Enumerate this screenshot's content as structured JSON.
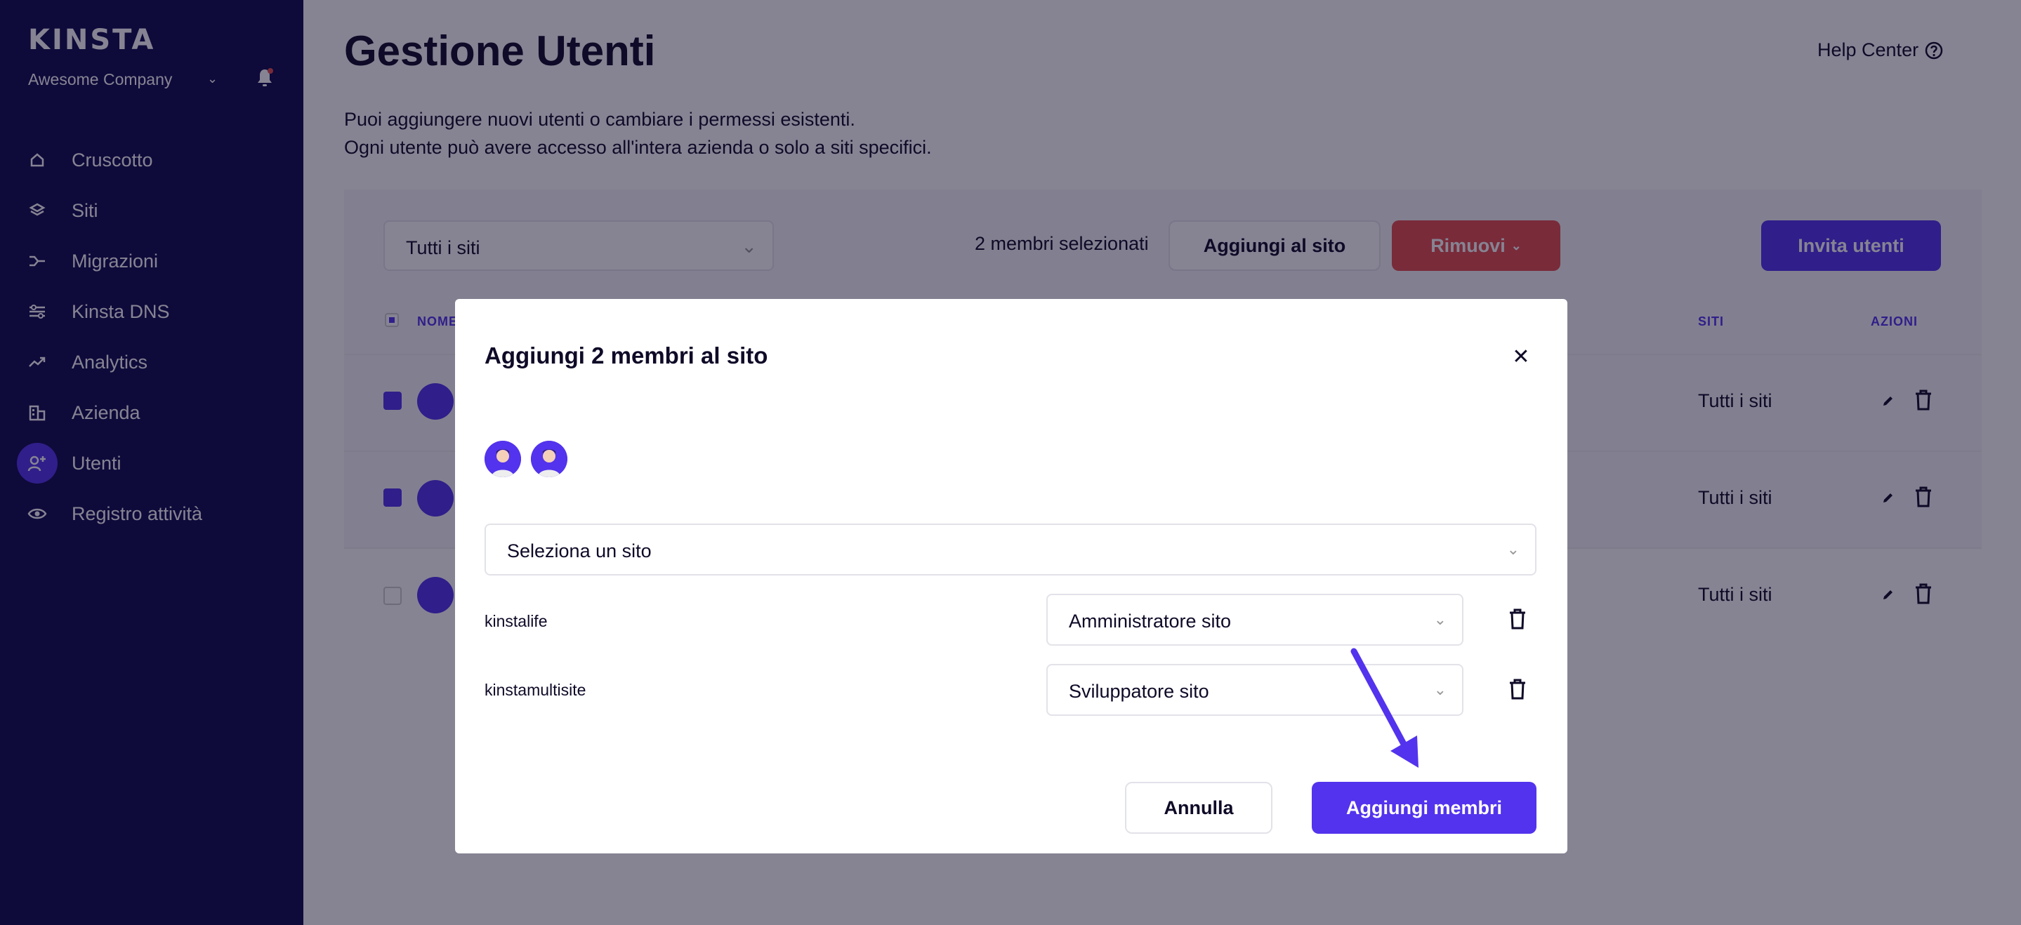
{
  "sidebar": {
    "logo": "KINSTA",
    "company": "Awesome Company",
    "items": [
      {
        "label": "Cruscotto",
        "icon": "home-icon"
      },
      {
        "label": "Siti",
        "icon": "layers-icon"
      },
      {
        "label": "Migrazioni",
        "icon": "migration-icon"
      },
      {
        "label": "Kinsta DNS",
        "icon": "dns-icon"
      },
      {
        "label": "Analytics",
        "icon": "trend-icon"
      },
      {
        "label": "Azienda",
        "icon": "building-icon"
      },
      {
        "label": "Utenti",
        "icon": "add-user-icon"
      },
      {
        "label": "Registro attività",
        "icon": "eye-icon"
      }
    ]
  },
  "header": {
    "title": "Gestione Utenti",
    "help": "Help Center",
    "sub1": "Puoi aggiungere nuovi utenti o cambiare i permessi esistenti.",
    "sub2": "Ogni utente può avere accesso all'intera azienda o solo a siti specifici."
  },
  "toolbar": {
    "filter_value": "Tutti i siti",
    "selected_count": "2 membri selezionati",
    "add_to_site": "Aggiungi al sito",
    "remove": "Rimuovi",
    "invite": "Invita utenti"
  },
  "table": {
    "headers": {
      "name": "NOME",
      "sites": "SITI",
      "actions": "AZIONI"
    },
    "rows": [
      {
        "checked": true,
        "sites": "Tutti i siti"
      },
      {
        "checked": true,
        "sites": "Tutti i siti"
      },
      {
        "checked": false,
        "sites": "Tutti i siti"
      }
    ]
  },
  "modal": {
    "title": "Aggiungi 2 membri al sito",
    "site_select_placeholder": "Seleziona un sito",
    "sites": [
      {
        "name": "kinstalife",
        "role": "Amministratore sito"
      },
      {
        "name": "kinstamultisite",
        "role": "Sviluppatore sito"
      }
    ],
    "cancel": "Annulla",
    "confirm": "Aggiungi membri"
  },
  "colors": {
    "primary": "#5333ed",
    "sidebar": "#0e0b4d",
    "danger": "#e54d4d",
    "text": "#0e0a27"
  }
}
